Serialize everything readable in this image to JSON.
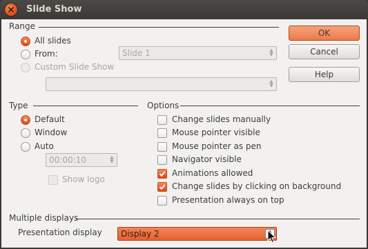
{
  "window": {
    "title": "Slide Show"
  },
  "range": {
    "heading": "Range",
    "all_slides": "All slides",
    "from": "From:",
    "from_value": "Slide 1",
    "custom": "Custom Slide Show",
    "custom_value": ""
  },
  "type": {
    "heading": "Type",
    "default": "Default",
    "window": "Window",
    "auto": "Auto",
    "pause_value": "00:00:10",
    "show_logo": "Show logo"
  },
  "options": {
    "heading": "Options",
    "items": [
      {
        "label": "Change slides manually",
        "checked": false
      },
      {
        "label": "Mouse pointer visible",
        "checked": false
      },
      {
        "label": "Mouse pointer as pen",
        "checked": false
      },
      {
        "label": "Navigator visible",
        "checked": false
      },
      {
        "label": "Animations allowed",
        "checked": true
      },
      {
        "label": "Change slides by clicking on background",
        "checked": true
      },
      {
        "label": "Presentation always on top",
        "checked": false
      }
    ]
  },
  "multiple_displays": {
    "heading": "Multiple displays",
    "presentation_display_label": "Presentation display",
    "presentation_display_value": "Display 2"
  },
  "buttons": {
    "ok": "OK",
    "cancel": "Cancel",
    "help": "Help"
  },
  "colors": {
    "accent": "#dd4814",
    "titlebar": "#3c3b37",
    "background": "#f2f1f0"
  }
}
